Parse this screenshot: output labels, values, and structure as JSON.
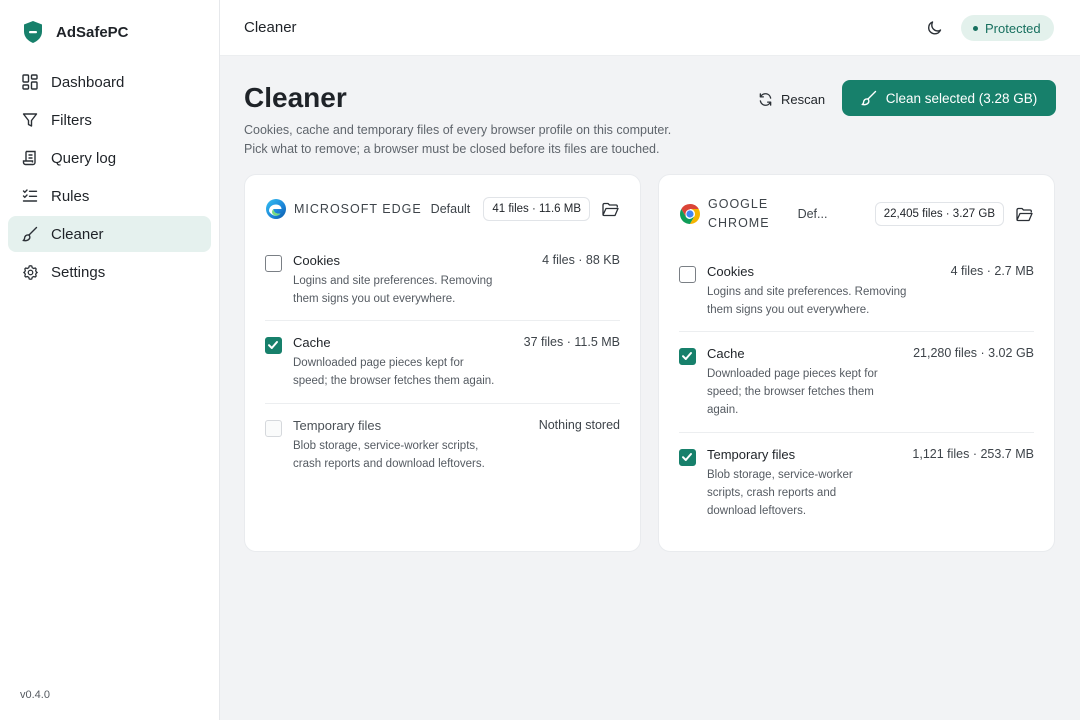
{
  "app": {
    "name": "AdSafePC",
    "version": "v0.4.0"
  },
  "sidebar": {
    "items": [
      {
        "label": "Dashboard",
        "icon": "dashboard-icon"
      },
      {
        "label": "Filters",
        "icon": "filter-icon"
      },
      {
        "label": "Query log",
        "icon": "scroll-icon"
      },
      {
        "label": "Rules",
        "icon": "rules-icon"
      },
      {
        "label": "Cleaner",
        "icon": "brush-icon",
        "active": true
      },
      {
        "label": "Settings",
        "icon": "gear-icon"
      }
    ]
  },
  "topbar": {
    "title": "Cleaner",
    "status": "Protected"
  },
  "page": {
    "title": "Cleaner",
    "desc_line1": "Cookies, cache and temporary files of every browser profile on this computer.",
    "desc_line2": "Pick what to remove; a browser must be closed before its files are touched.",
    "rescan_label": "Rescan",
    "clean_label": "Clean selected (3.28 GB)"
  },
  "colors": {
    "accent": "#17806b",
    "badge_bg": "#e3f1ec",
    "badge_text": "#17705f"
  },
  "browsers": [
    {
      "name": "MICROSOFT EDGE",
      "profile": "Default",
      "stats": "41 files · 11.6 MB",
      "items": [
        {
          "title": "Cookies",
          "desc_line1": "Logins and site preferences. Removing",
          "desc_line2": "them signs you out everywhere.",
          "size": "4 files · 88 KB",
          "checked": false
        },
        {
          "title": "Cache",
          "desc_line1": "Downloaded page pieces kept for",
          "desc_line2": "speed; the browser fetches them again.",
          "size": "37 files · 11.5 MB",
          "checked": true
        },
        {
          "title": "Temporary files",
          "desc_line1": "Blob storage, service-worker scripts,",
          "desc_line2": "crash reports and download leftovers.",
          "size": "Nothing stored",
          "checked": false,
          "disabled": true
        }
      ]
    },
    {
      "name_line1": "GOOGLE",
      "name_line2": "CHROME",
      "profile": "Def...",
      "stats": "22,405 files · 3.27 GB",
      "items": [
        {
          "title": "Cookies",
          "desc_line1": "Logins and site preferences. Removing",
          "desc_line2": "them signs you out everywhere.",
          "size": "4 files · 2.7 MB",
          "checked": false
        },
        {
          "title": "Cache",
          "desc_line1": "Downloaded page pieces kept for",
          "desc_line2": "speed; the browser fetches them",
          "desc_line3": "again.",
          "size": "21,280 files · 3.02 GB",
          "checked": true
        },
        {
          "title": "Temporary files",
          "desc_line1": "Blob storage, service-worker",
          "desc_line2": "scripts, crash reports and",
          "desc_line3": "download leftovers.",
          "size": "1,121 files · 253.7 MB",
          "checked": true
        }
      ]
    }
  ]
}
